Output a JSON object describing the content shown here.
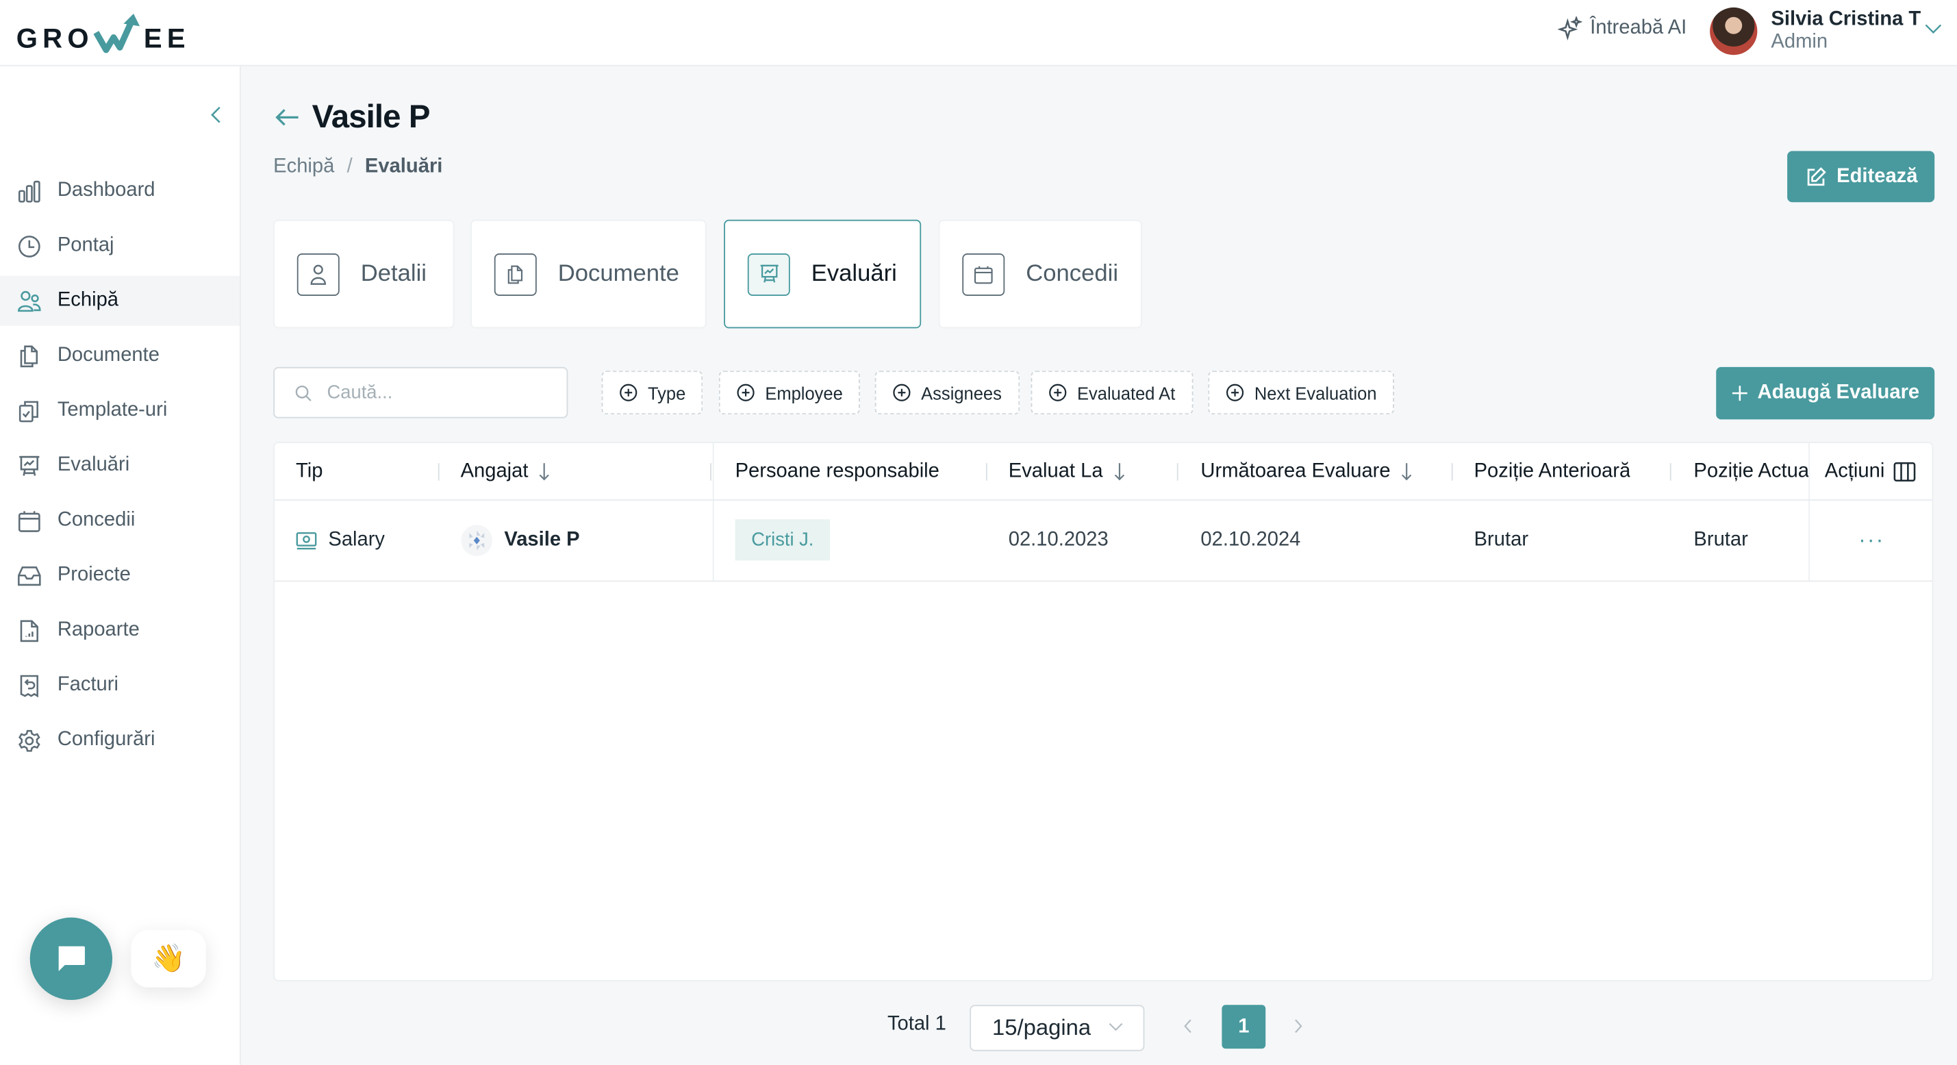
{
  "app": {
    "logo_left": "GRO",
    "logo_right": "EE",
    "accent": "#489a9e"
  },
  "topbar": {
    "ask_ai_label": "Întreabă AI",
    "user_name": "Silvia Cristina T",
    "user_role": "Admin"
  },
  "sidebar": {
    "items": [
      {
        "label": "Dashboard",
        "icon": "bar-chart-icon"
      },
      {
        "label": "Pontaj",
        "icon": "clock-icon"
      },
      {
        "label": "Echipă",
        "icon": "users-icon",
        "active": true
      },
      {
        "label": "Documente",
        "icon": "documents-icon"
      },
      {
        "label": "Template-uri",
        "icon": "clipboard-check-icon"
      },
      {
        "label": "Evaluări",
        "icon": "presentation-chart-icon"
      },
      {
        "label": "Concedii",
        "icon": "calendar-icon"
      },
      {
        "label": "Proiecte",
        "icon": "inbox-icon"
      },
      {
        "label": "Rapoarte",
        "icon": "report-file-icon"
      },
      {
        "label": "Facturi",
        "icon": "receipt-icon"
      },
      {
        "label": "Configurări",
        "icon": "gear-icon"
      }
    ],
    "wave_emoji": "👋"
  },
  "page": {
    "title": "Vasile P",
    "breadcrumb": [
      "Echipă",
      "Evaluări"
    ],
    "breadcrumb_sep": "/",
    "edit_label": "Editează"
  },
  "tabs": [
    {
      "label": "Detalii",
      "icon": "user-icon"
    },
    {
      "label": "Documente",
      "icon": "documents-icon"
    },
    {
      "label": "Evaluări",
      "icon": "presentation-chart-icon",
      "active": true
    },
    {
      "label": "Concedii",
      "icon": "calendar-icon"
    }
  ],
  "filters": {
    "search_placeholder": "Caută...",
    "search_value": "",
    "chips": [
      "Type",
      "Employee",
      "Assignees",
      "Evaluated At",
      "Next Evaluation"
    ],
    "add_label": "Adaugă Evaluare"
  },
  "table": {
    "columns": [
      "Tip",
      "Angajat",
      "Persoane responsabile",
      "Evaluat La",
      "Următoarea Evaluare",
      "Poziție Anterioară",
      "Poziție Actuală",
      "Acțiuni"
    ],
    "columns_visible": [
      "Tip",
      "Angajat",
      "Persoane responsabile",
      "Evaluat La",
      "Următoarea Evaluare",
      "Poziție Anterioară",
      "Poziție Actua",
      "Acțiuni"
    ],
    "rows": [
      {
        "type": "Salary",
        "employee": "Vasile P",
        "assignees": [
          "Cristi J."
        ],
        "evaluated_at": "02.10.2023",
        "next_evaluation": "02.10.2024",
        "previous_position": "Brutar",
        "current_position": "Brutar",
        "actions": "···"
      }
    ]
  },
  "pagination": {
    "total_label": "Total 1",
    "page_size": "15/pagina",
    "current_page": "1"
  }
}
